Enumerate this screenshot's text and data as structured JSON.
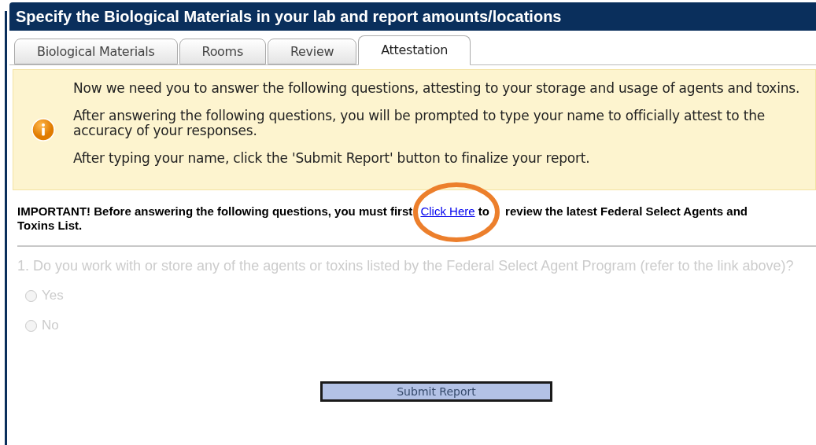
{
  "header": {
    "title": "Specify the Biological Materials in your lab and report amounts/locations"
  },
  "tabs": [
    {
      "label": "Biological Materials",
      "selected": false
    },
    {
      "label": "Rooms",
      "selected": false
    },
    {
      "label": "Review",
      "selected": false
    },
    {
      "label": "Attestation",
      "selected": true
    }
  ],
  "info": {
    "paragraphs": [
      "Now we need you to answer the following questions, attesting to your storage and usage of agents and toxins.",
      "After answering the following questions, you will be prompted to type your name to officially attest to the accuracy of your responses.",
      "After typing your name, click the 'Submit Report' button to finalize your report."
    ]
  },
  "important": {
    "before": "IMPORTANT! Before answering the following questions, you must first",
    "link": "Click Here",
    "after": "to review the latest Federal Select Agents and Toxins List.",
    "highlighted": true
  },
  "question": {
    "text": "1. Do you work with or store any of the agents or toxins listed by the Federal Select Agent Program (refer to the link above)?",
    "disabled": true,
    "options": [
      {
        "label": "Yes",
        "selected": false
      },
      {
        "label": "No",
        "selected": false
      }
    ]
  },
  "submit_button": {
    "label": "Submit Report"
  }
}
